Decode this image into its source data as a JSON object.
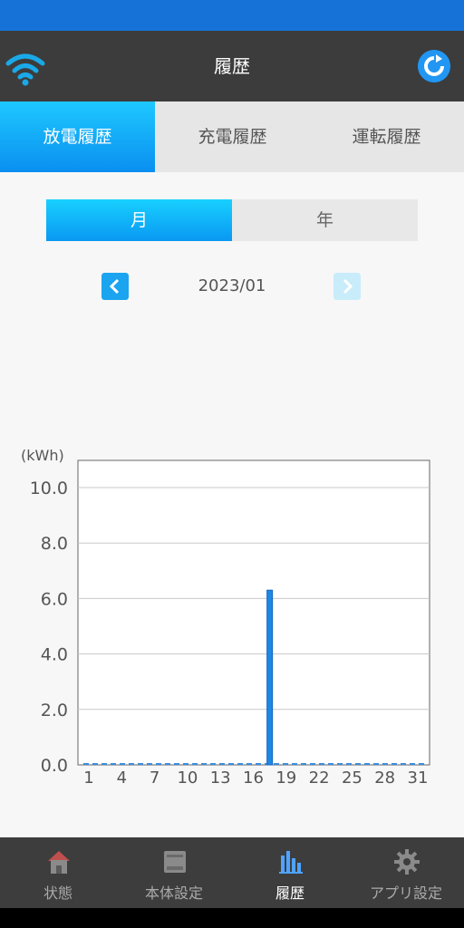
{
  "header": {
    "title": "履歴"
  },
  "tabs": [
    {
      "label": "放電履歴",
      "active": true
    },
    {
      "label": "充電履歴",
      "active": false
    },
    {
      "label": "運転履歴",
      "active": false
    }
  ],
  "segment": [
    {
      "label": "月",
      "active": true
    },
    {
      "label": "年",
      "active": false
    }
  ],
  "period": {
    "label": "2023/01"
  },
  "bottom_nav": [
    {
      "label": "状態",
      "icon": "home-icon",
      "active": false
    },
    {
      "label": "本体設定",
      "icon": "device-icon",
      "active": false
    },
    {
      "label": "履歴",
      "icon": "bar-chart-icon",
      "active": true
    },
    {
      "label": "アプリ設定",
      "icon": "gear-icon",
      "active": false
    }
  ],
  "colors": {
    "accent": "#0a8ff0",
    "bar": "#1e88e5",
    "appbar": "#3c3c3c",
    "statusbar": "#1672d6"
  },
  "chart_data": {
    "type": "bar",
    "ylabel": "(kWh)",
    "ylim": [
      0,
      10.0
    ],
    "yticks": [
      "10.0",
      "8.0",
      "6.0",
      "4.0",
      "2.0",
      "0.0"
    ],
    "xtick_labels": [
      "1",
      "4",
      "7",
      "10",
      "13",
      "16",
      "19",
      "22",
      "25",
      "28",
      "31"
    ],
    "categories": [
      "1",
      "2",
      "3",
      "4",
      "5",
      "6",
      "7",
      "8",
      "9",
      "10",
      "11",
      "12",
      "13",
      "14",
      "15",
      "16",
      "17",
      "18",
      "19",
      "20",
      "21",
      "22",
      "23",
      "24",
      "25",
      "26",
      "27",
      "28",
      "29",
      "30",
      "31"
    ],
    "values": [
      0,
      0,
      0,
      0,
      0,
      0,
      0,
      0,
      0,
      0,
      0,
      0,
      0,
      0,
      0,
      0,
      6.3,
      0,
      0,
      0,
      0,
      0,
      0,
      0,
      0,
      0,
      0,
      0,
      0,
      0,
      0
    ],
    "grid": true
  }
}
